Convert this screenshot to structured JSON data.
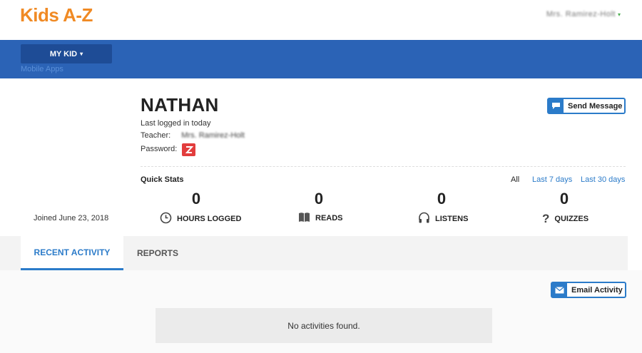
{
  "header": {
    "logo": "Kids A-Z",
    "account_name": "Mrs. Ramirez-Holt",
    "account_caret": "▾"
  },
  "nav": {
    "my_kid_label": "MY KID",
    "my_kid_caret": "▾",
    "mobile_apps_label": "Mobile Apps"
  },
  "profile": {
    "name": "NATHAN",
    "last_logged": "Last logged in today",
    "teacher_label": "Teacher:",
    "teacher_value": "Mrs. Ramirez-Holt",
    "password_label": "Password:",
    "password_icon": "z-letter-icon",
    "send_message_label": "Send Message",
    "joined": "Joined June 23, 2018"
  },
  "quick_stats": {
    "title": "Quick Stats",
    "ranges": [
      "All",
      "Last 7 days",
      "Last 30 days"
    ],
    "selected_range": "All",
    "stats": [
      {
        "value": "0",
        "label": "HOURS LOGGED",
        "icon": "clock-icon"
      },
      {
        "value": "0",
        "label": "READS",
        "icon": "book-icon"
      },
      {
        "value": "0",
        "label": "LISTENS",
        "icon": "headphones-icon"
      },
      {
        "value": "0",
        "label": "QUIZZES",
        "icon": "question-icon"
      }
    ]
  },
  "tabs": {
    "recent_activity": "RECENT ACTIVITY",
    "reports": "REPORTS",
    "active": "RECENT ACTIVITY"
  },
  "activity": {
    "email_activity_label": "Email Activity",
    "empty_message": "No activities found."
  },
  "colors": {
    "brand_orange": "#f08a24",
    "nav_blue": "#2b63b6",
    "accent_blue": "#2b7bc9",
    "password_red": "#e23d3d"
  }
}
